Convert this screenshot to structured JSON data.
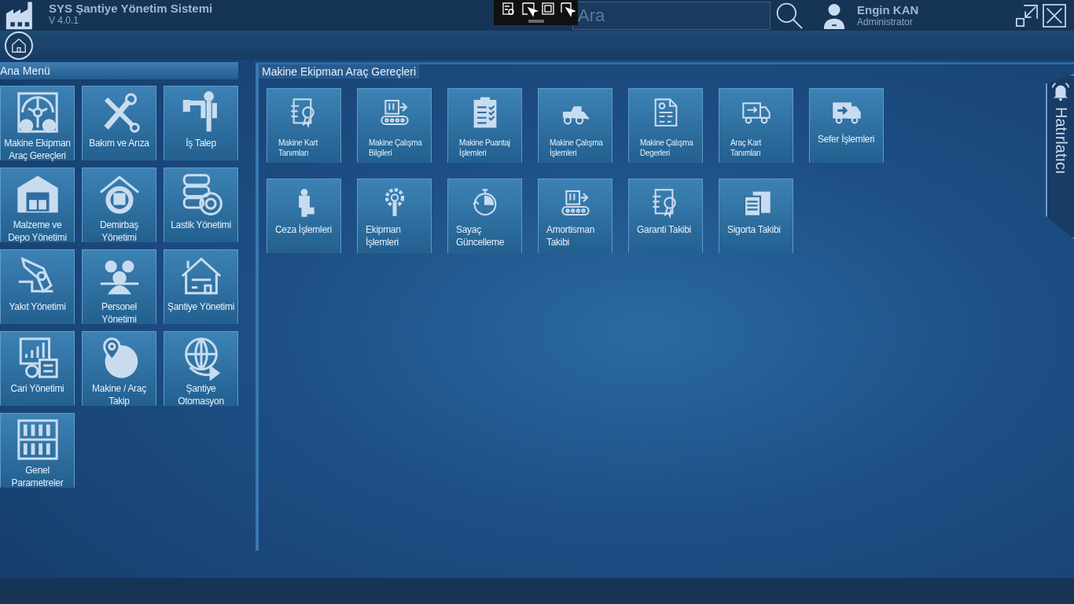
{
  "app": {
    "title": "SYS Şantiye Yönetim Sistemi",
    "version": "V 4.0.1"
  },
  "search": {
    "placeholder": "Ara"
  },
  "user": {
    "name": "Engin KAN",
    "role": "Administrator"
  },
  "main_menu": {
    "title": "Ana Menü",
    "items": [
      {
        "label": "Makine Ekipman Araç Gereçleri"
      },
      {
        "label": "Bakım ve Arıza"
      },
      {
        "label": "İş Talep"
      },
      {
        "label": "Malzeme ve Depo Yönetimi"
      },
      {
        "label": "Demirbaş Yönetimi"
      },
      {
        "label": "Lastik Yönetimi"
      },
      {
        "label": "Yakıt Yönetimi"
      },
      {
        "label": "Personel Yönetimi"
      },
      {
        "label": "Şantiye Yönetimi"
      },
      {
        "label": "Cari Yönetimi"
      },
      {
        "label": "Makine / Araç Takip"
      },
      {
        "label": "Şantiye Otomasyon"
      },
      {
        "label": "Genel Parametreler"
      }
    ]
  },
  "content": {
    "title": "Makine Ekipman Araç Gereçleri",
    "rows": [
      [
        {
          "label": "Makine Kart Tanımları"
        },
        {
          "label": "Makine Çalışma Bilgileri"
        },
        {
          "label": "Makine Puantaj İşlemleri"
        },
        {
          "label": "Makine Çalışma İşlemleri"
        },
        {
          "label": "Makine Çalışma Degerleri"
        },
        {
          "label": "Araç Kart Tanımları"
        },
        {
          "label": "Sefer İşlemleri"
        }
      ],
      [
        {
          "label": "Ceza İşlemleri"
        },
        {
          "label": "Ekipman İşlemleri"
        },
        {
          "label": "Sayaç Güncelleme"
        },
        {
          "label": "Amortisman Takibi"
        },
        {
          "label": "Garanti Takibi"
        },
        {
          "label": "Sigorta Takibi"
        }
      ]
    ]
  },
  "reminder": {
    "label": "Hatırlatıcı"
  }
}
